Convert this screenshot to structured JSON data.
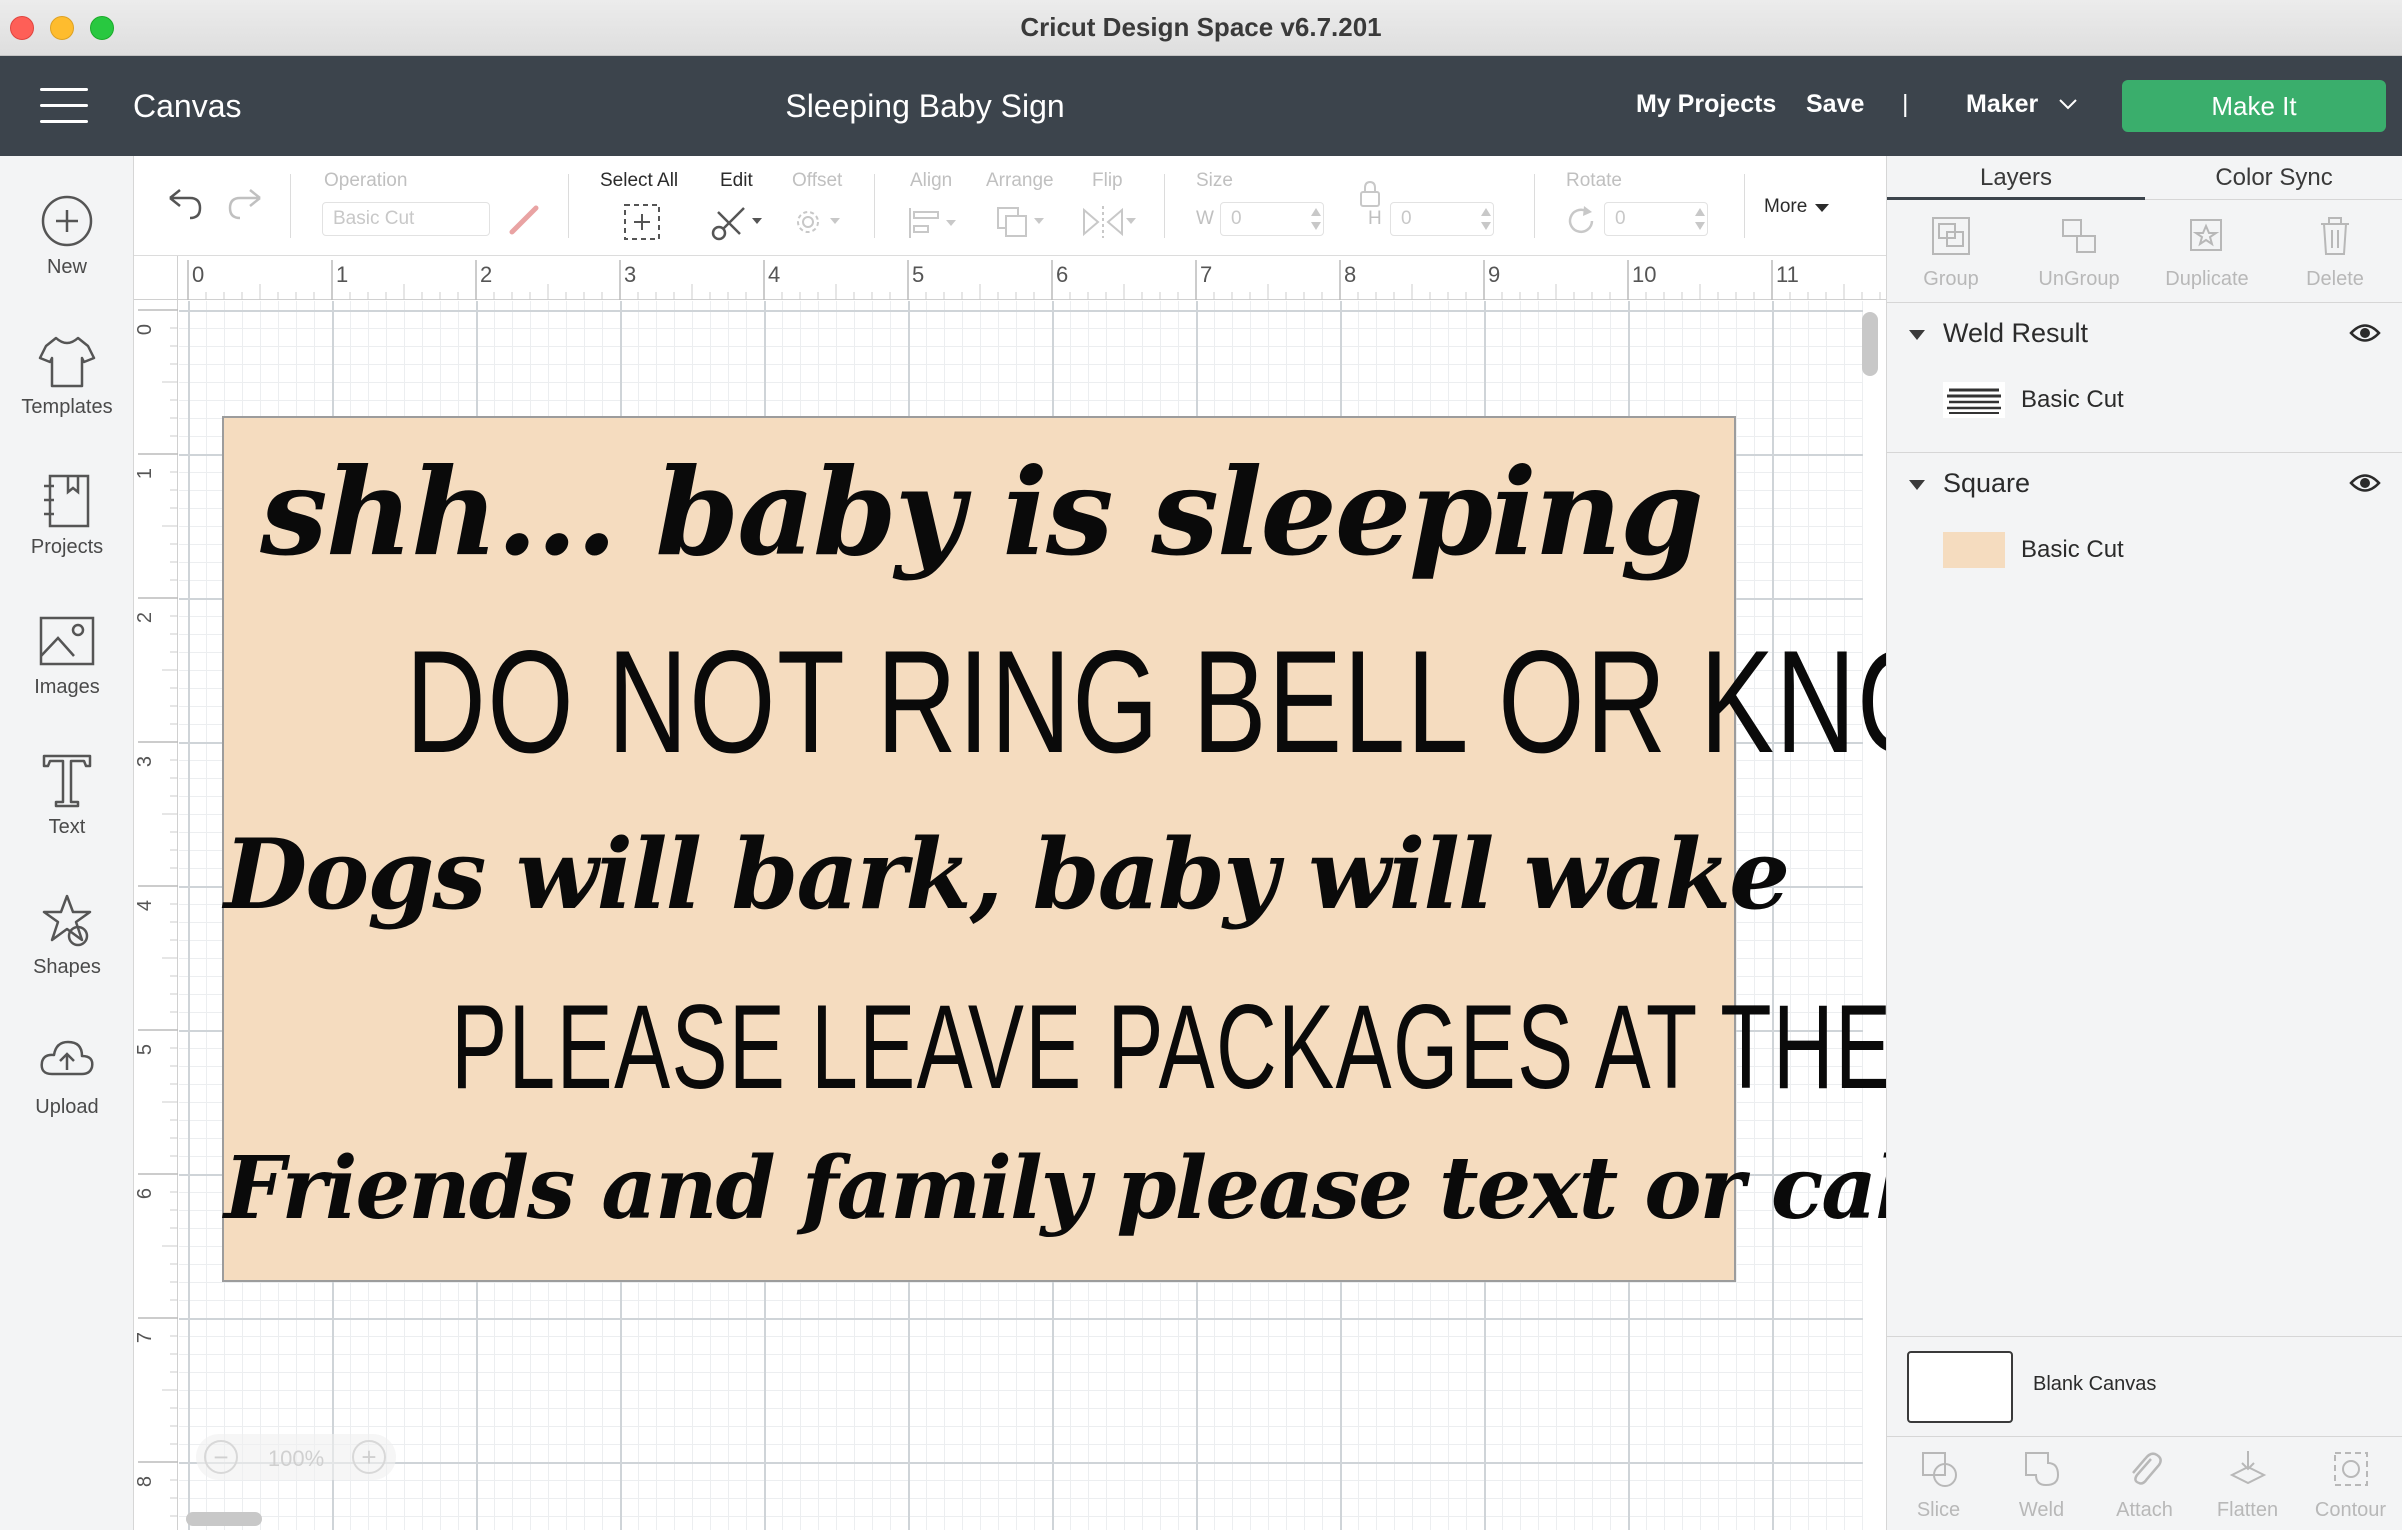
{
  "window": {
    "title": "Cricut Design Space  v6.7.201"
  },
  "header": {
    "section": "Canvas",
    "project_title": "Sleeping Baby Sign",
    "my_projects": "My Projects",
    "save": "Save",
    "divider": "|",
    "machine": "Maker",
    "make_it": "Make It",
    "make_it_color": "#3aae6c"
  },
  "sidebar": {
    "items": [
      {
        "label": "New",
        "icon": "plus-circle-icon"
      },
      {
        "label": "Templates",
        "icon": "tshirt-icon"
      },
      {
        "label": "Projects",
        "icon": "notebook-icon"
      },
      {
        "label": "Images",
        "icon": "image-icon"
      },
      {
        "label": "Text",
        "icon": "text-t-icon"
      },
      {
        "label": "Shapes",
        "icon": "shapes-icon"
      },
      {
        "label": "Upload",
        "icon": "cloud-upload-icon"
      }
    ]
  },
  "toolbar": {
    "operation_label": "Operation",
    "operation_value": "Basic Cut",
    "select_all": "Select All",
    "edit": "Edit",
    "offset": "Offset",
    "align": "Align",
    "arrange": "Arrange",
    "flip": "Flip",
    "size": "Size",
    "w_label": "W",
    "w_value": "0",
    "h_label": "H",
    "h_value": "0",
    "rotate": "Rotate",
    "rotate_value": "0",
    "more": "More"
  },
  "canvas": {
    "ruler_x": [
      "0",
      "1",
      "2",
      "3",
      "4",
      "5",
      "6",
      "7",
      "8",
      "9",
      "10",
      "11"
    ],
    "ruler_y": [
      "0",
      "1",
      "2",
      "3",
      "4",
      "5",
      "6",
      "7",
      "8"
    ],
    "zoom": "100%",
    "sign_color": "#f5dcbf",
    "sign_lines": [
      "shh... baby is sleeping",
      "DO NOT RING BELL OR KNOCK",
      "Dogs will bark, baby will wake",
      "PLEASE LEAVE PACKAGES AT THE DOOR",
      "Friends and family please text or call"
    ]
  },
  "panel": {
    "tabs": {
      "layers": "Layers",
      "color_sync": "Color Sync"
    },
    "actions": [
      "Group",
      "UnGroup",
      "Duplicate",
      "Delete"
    ],
    "groups": [
      {
        "name": "Weld Result",
        "layer": "Basic Cut"
      },
      {
        "name": "Square",
        "layer": "Basic Cut",
        "swatch": "#f5dcbf"
      }
    ],
    "blank_canvas": "Blank Canvas",
    "bottom_actions": [
      "Slice",
      "Weld",
      "Attach",
      "Flatten",
      "Contour"
    ]
  }
}
